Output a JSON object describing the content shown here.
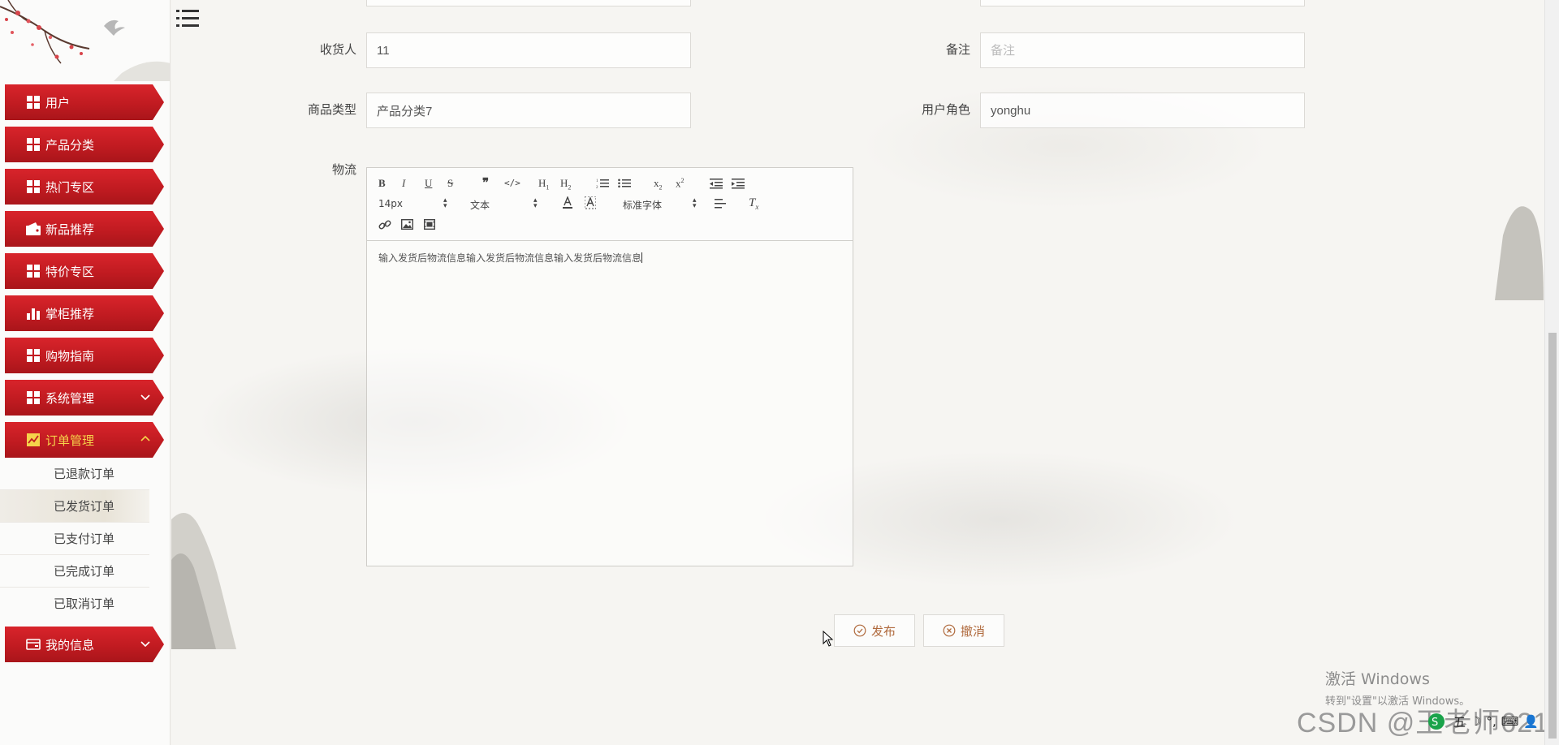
{
  "sidebar": {
    "items": [
      {
        "label": "用户",
        "icon": "grid-icon"
      },
      {
        "label": "产品分类",
        "icon": "grid-icon"
      },
      {
        "label": "热门专区",
        "icon": "grid-icon"
      },
      {
        "label": "新品推荐",
        "icon": "wallet-icon"
      },
      {
        "label": "特价专区",
        "icon": "grid-icon"
      },
      {
        "label": "掌柜推荐",
        "icon": "bar-chart-icon"
      },
      {
        "label": "购物指南",
        "icon": "grid-icon"
      },
      {
        "label": "系统管理",
        "icon": "grid-icon",
        "expandable": true
      },
      {
        "label": "订单管理",
        "icon": "trend-chart-icon",
        "expandable": true,
        "expanded": true
      }
    ],
    "order_submenu": [
      "已退款订单",
      "已发货订单",
      "已支付订单",
      "已完成订单",
      "已取消订单"
    ],
    "selected_submenu": "已发货订单",
    "last_item": {
      "label": "我的信息",
      "icon": "card-icon",
      "expandable": true
    }
  },
  "form": {
    "receiver": {
      "label": "收货人",
      "value": "11"
    },
    "remark": {
      "label": "备注",
      "placeholder": "备注"
    },
    "product_type": {
      "label": "商品类型",
      "value": "产品分类7"
    },
    "user_role": {
      "label": "用户角色",
      "value": "yonghu"
    },
    "logistics": {
      "label": "物流",
      "content": "输入发货后物流信息输入发货后物流信息输入发货后物流信息"
    }
  },
  "editor_toolbar": {
    "font_size": "14px",
    "format": "文本",
    "font_family": "标准字体"
  },
  "actions": {
    "publish": "发布",
    "cancel": "撤消"
  },
  "watermark": {
    "activate_title": "激活 Windows",
    "activate_sub": "转到\"设置\"以激活 Windows。",
    "csdn": "CSDN @王老师621"
  },
  "colors": {
    "menu_red": "#c11b21",
    "active_label": "#f5d24a",
    "button_text": "#b06a3d"
  }
}
